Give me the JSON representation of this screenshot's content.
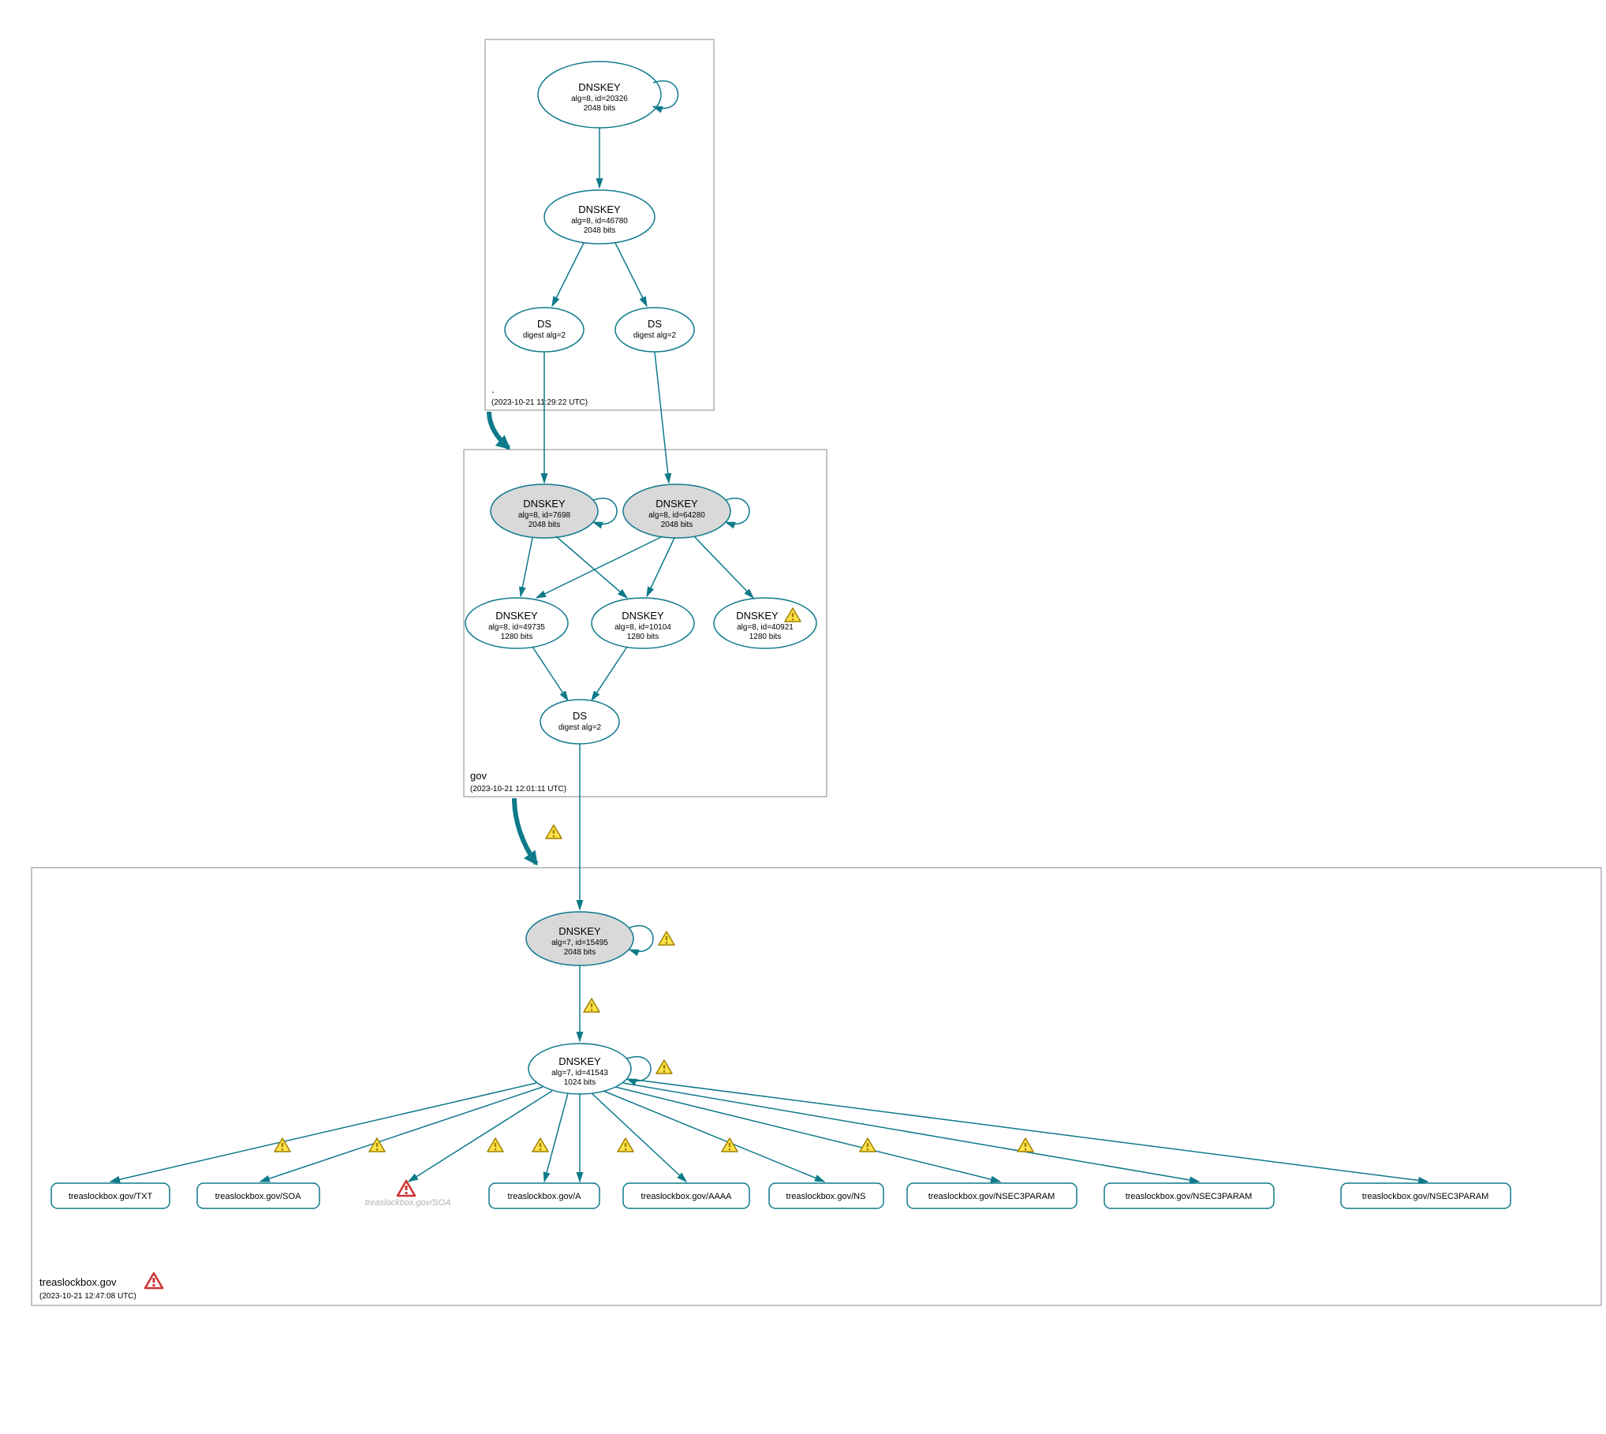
{
  "zones": {
    "root": {
      "label": ".",
      "timestamp": "(2023-10-21 11:29:22 UTC)"
    },
    "gov": {
      "label": "gov",
      "timestamp": "(2023-10-21 12:01:11 UTC)"
    },
    "treaslockbox": {
      "label": "treaslockbox.gov",
      "timestamp": "(2023-10-21 12:47:08 UTC)"
    }
  },
  "nodes": {
    "root_ksk": {
      "title": "DNSKEY",
      "line1": "alg=8, id=20326",
      "line2": "2048 bits"
    },
    "root_zsk": {
      "title": "DNSKEY",
      "line1": "alg=8, id=46780",
      "line2": "2048 bits"
    },
    "root_ds1": {
      "title": "DS",
      "line1": "digest alg=2",
      "line2": ""
    },
    "root_ds2": {
      "title": "DS",
      "line1": "digest alg=2",
      "line2": ""
    },
    "gov_ksk1": {
      "title": "DNSKEY",
      "line1": "alg=8, id=7698",
      "line2": "2048 bits"
    },
    "gov_ksk2": {
      "title": "DNSKEY",
      "line1": "alg=8, id=64280",
      "line2": "2048 bits"
    },
    "gov_zsk1": {
      "title": "DNSKEY",
      "line1": "alg=8, id=49735",
      "line2": "1280 bits"
    },
    "gov_zsk2": {
      "title": "DNSKEY",
      "line1": "alg=8, id=10104",
      "line2": "1280 bits"
    },
    "gov_zsk3": {
      "title": "DNSKEY",
      "line1": "alg=8, id=40921",
      "line2": "1280 bits"
    },
    "gov_ds": {
      "title": "DS",
      "line1": "digest alg=2",
      "line2": ""
    },
    "tl_ksk": {
      "title": "DNSKEY",
      "line1": "alg=7, id=15495",
      "line2": "2048 bits"
    },
    "tl_zsk": {
      "title": "DNSKEY",
      "line1": "alg=7, id=41543",
      "line2": "1024 bits"
    }
  },
  "rrsets": {
    "txt": "treaslockbox.gov/TXT",
    "soa": "treaslockbox.gov/SOA",
    "soa2": "treaslockbox.gov/SOA",
    "a": "treaslockbox.gov/A",
    "aaaa": "treaslockbox.gov/AAAA",
    "ns": "treaslockbox.gov/NS",
    "n3p1": "treaslockbox.gov/NSEC3PARAM",
    "n3p2": "treaslockbox.gov/NSEC3PARAM",
    "n3p3": "treaslockbox.gov/NSEC3PARAM"
  }
}
